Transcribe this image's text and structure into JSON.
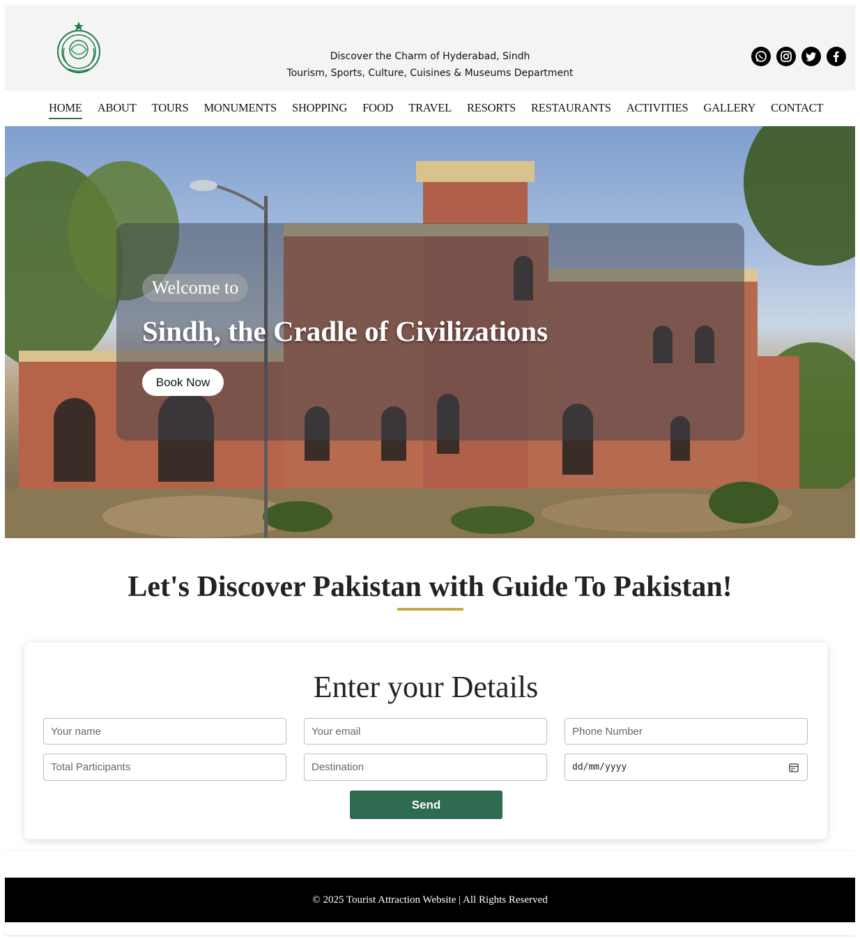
{
  "header": {
    "tagline_line1": "Discover the Charm of Hyderabad, Sindh",
    "tagline_line2": "Tourism, Sports, Culture, Cuisines & Museums Department",
    "logo_icon": "government-emblem-icon",
    "social": [
      {
        "icon": "whatsapp-icon",
        "glyph": "✆"
      },
      {
        "icon": "instagram-icon",
        "glyph": "◎"
      },
      {
        "icon": "twitter-icon",
        "glyph": "🐦"
      },
      {
        "icon": "facebook-icon",
        "glyph": "f"
      }
    ]
  },
  "nav": {
    "items": [
      "HOME",
      "ABOUT",
      "TOURS",
      "MONUMENTS",
      "SHOPPING",
      "FOOD",
      "TRAVEL",
      "RESORTS",
      "RESTAURANTS",
      "ACTIVITIES",
      "GALLERY",
      "CONTACT"
    ],
    "active": "HOME",
    "active_color": "#2a7a3a"
  },
  "hero": {
    "welcome": "Welcome to",
    "title": "Sindh, the Cradle of Civilizations",
    "button": "Book Now"
  },
  "discover": {
    "heading": "Let's Discover Pakistan with Guide To Pakistan!",
    "accent_color": "#c8a84a"
  },
  "form": {
    "title": "Enter your Details",
    "name_placeholder": "Your name",
    "email_placeholder": "Your email",
    "phone_placeholder": "Phone Number",
    "participants_placeholder": "Total Participants",
    "destination_placeholder": "Destination",
    "date_placeholder": "dd/mm/yyyy",
    "send": "Send",
    "send_color": "#2e6b50"
  },
  "footer": {
    "text": "© 2025 Tourist Attraction Website | All Rights Reserved"
  }
}
